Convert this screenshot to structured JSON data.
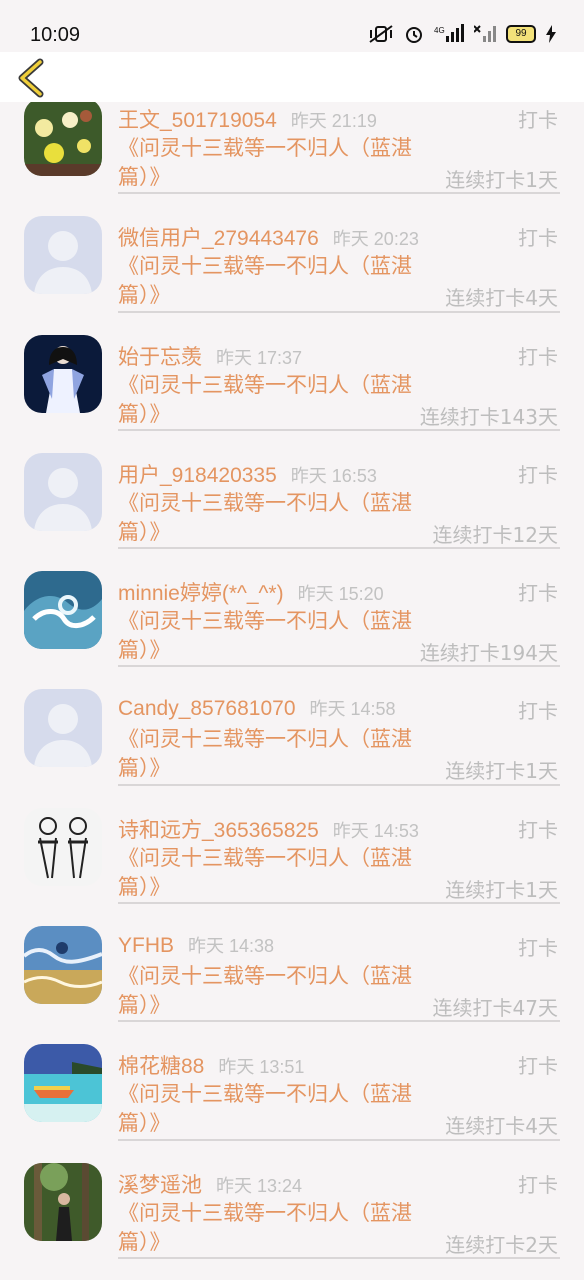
{
  "status": {
    "time": "10:09",
    "battery": "99"
  },
  "entries": [
    {
      "name": "王文_501719054",
      "time": "昨天 21:19",
      "tag": "打卡",
      "book": "《问灵十三载等一不归人（蓝湛篇）》",
      "streak": "连续打卡1天",
      "avatar": "flowers-photo-avatar"
    },
    {
      "name": "微信用户_279443476",
      "time": "昨天 20:23",
      "tag": "打卡",
      "book": "《问灵十三载等一不归人（蓝湛篇）》",
      "streak": "连续打卡4天",
      "avatar": "default-avatar"
    },
    {
      "name": "始于忘羡",
      "time": "昨天 17:37",
      "tag": "打卡",
      "book": "《问灵十三载等一不归人（蓝湛篇）》",
      "streak": "连续打卡143天",
      "avatar": "costume-figure-avatar"
    },
    {
      "name": "用户_918420335",
      "time": "昨天 16:53",
      "tag": "打卡",
      "book": "《问灵十三载等一不归人（蓝湛篇）》",
      "streak": "连续打卡12天",
      "avatar": "default-avatar"
    },
    {
      "name": "minnie婷婷(*^_^*)",
      "time": "昨天 15:20",
      "tag": "打卡",
      "book": "《问灵十三载等一不归人（蓝湛篇）》",
      "streak": "连续打卡194天",
      "avatar": "wave-photo-avatar"
    },
    {
      "name": "Candy_857681070",
      "time": "昨天 14:58",
      "tag": "打卡",
      "book": "《问灵十三载等一不归人（蓝湛篇）》",
      "streak": "连续打卡1天",
      "avatar": "default-avatar"
    },
    {
      "name": "诗和远方_365365825",
      "time": "昨天 14:53",
      "tag": "打卡",
      "book": "《问灵十三载等一不归人（蓝湛篇）》",
      "streak": "连续打卡1天",
      "avatar": "sketch-couple-avatar"
    },
    {
      "name": "YFHB",
      "time": "昨天 14:38",
      "tag": "打卡",
      "book": "《问灵十三载等一不归人（蓝湛篇）》",
      "streak": "连续打卡47天",
      "avatar": "sea-painting-avatar"
    },
    {
      "name": "棉花糖88",
      "time": "昨天 13:51",
      "tag": "打卡",
      "book": "《问灵十三载等一不归人（蓝湛篇）》",
      "streak": "连续打卡4天",
      "avatar": "beach-boat-avatar"
    },
    {
      "name": "溪梦遥池",
      "time": "昨天 13:24",
      "tag": "打卡",
      "book": "《问灵十三载等一不归人（蓝湛篇）》",
      "streak": "连续打卡2天",
      "avatar": "forest-person-avatar"
    }
  ]
}
